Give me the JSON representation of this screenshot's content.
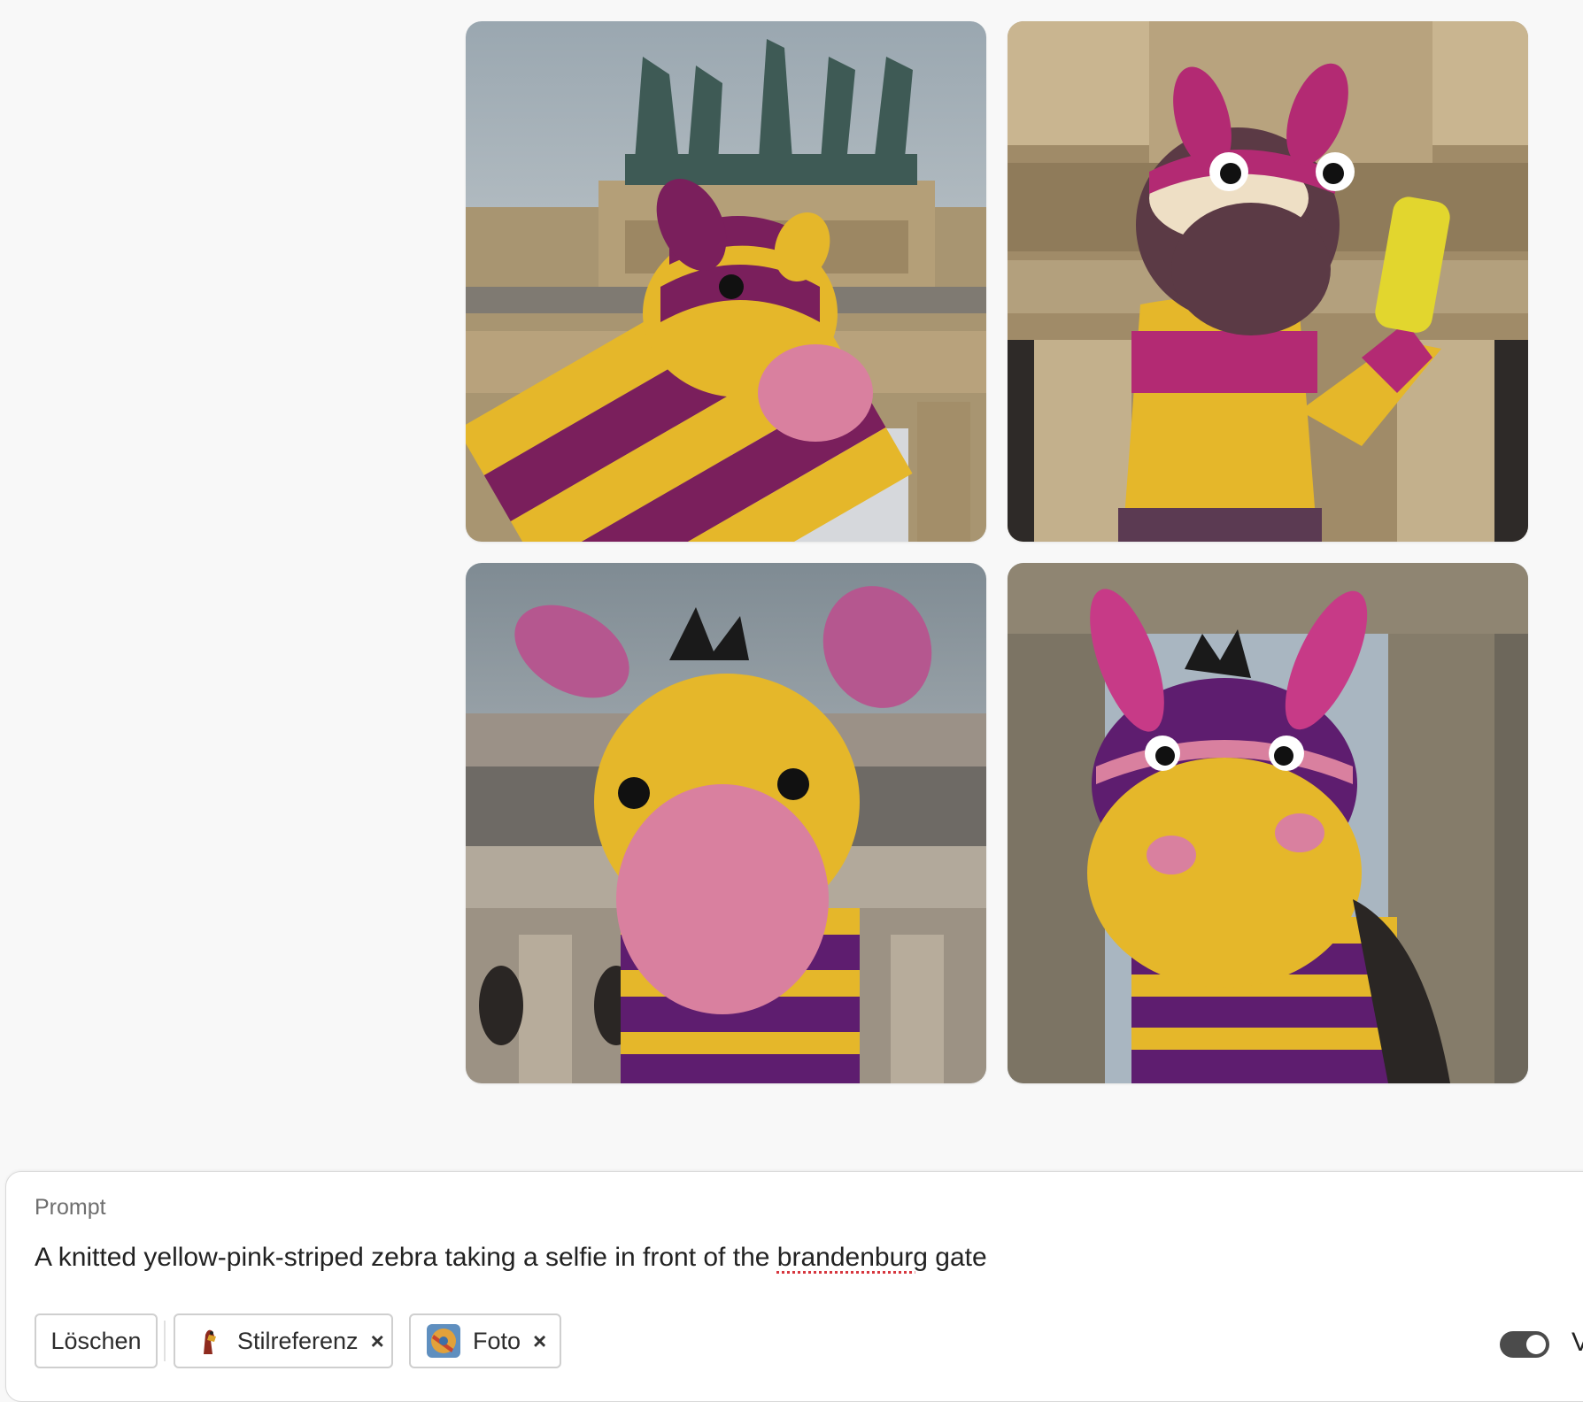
{
  "gallery": {
    "images": [
      {
        "name": "result-image-1"
      },
      {
        "name": "result-image-2"
      },
      {
        "name": "result-image-3"
      },
      {
        "name": "result-image-4"
      }
    ]
  },
  "prompt": {
    "label": "Prompt",
    "text_before": "A knitted yellow-pink-striped zebra taking a selfie in front of the ",
    "text_misspelled": "brandenburg",
    "text_after": " gate"
  },
  "actions": {
    "clear_label": "Löschen",
    "style_ref_label": "Stilreferenz",
    "photo_label": "Foto",
    "remove_symbol": "×",
    "toggle_label": "V",
    "toggle_on": true
  },
  "colors": {
    "yellow": "#e5b72a",
    "purple": "#7a1f5c",
    "pink": "#d9809f",
    "stone": "#b59f7c"
  }
}
